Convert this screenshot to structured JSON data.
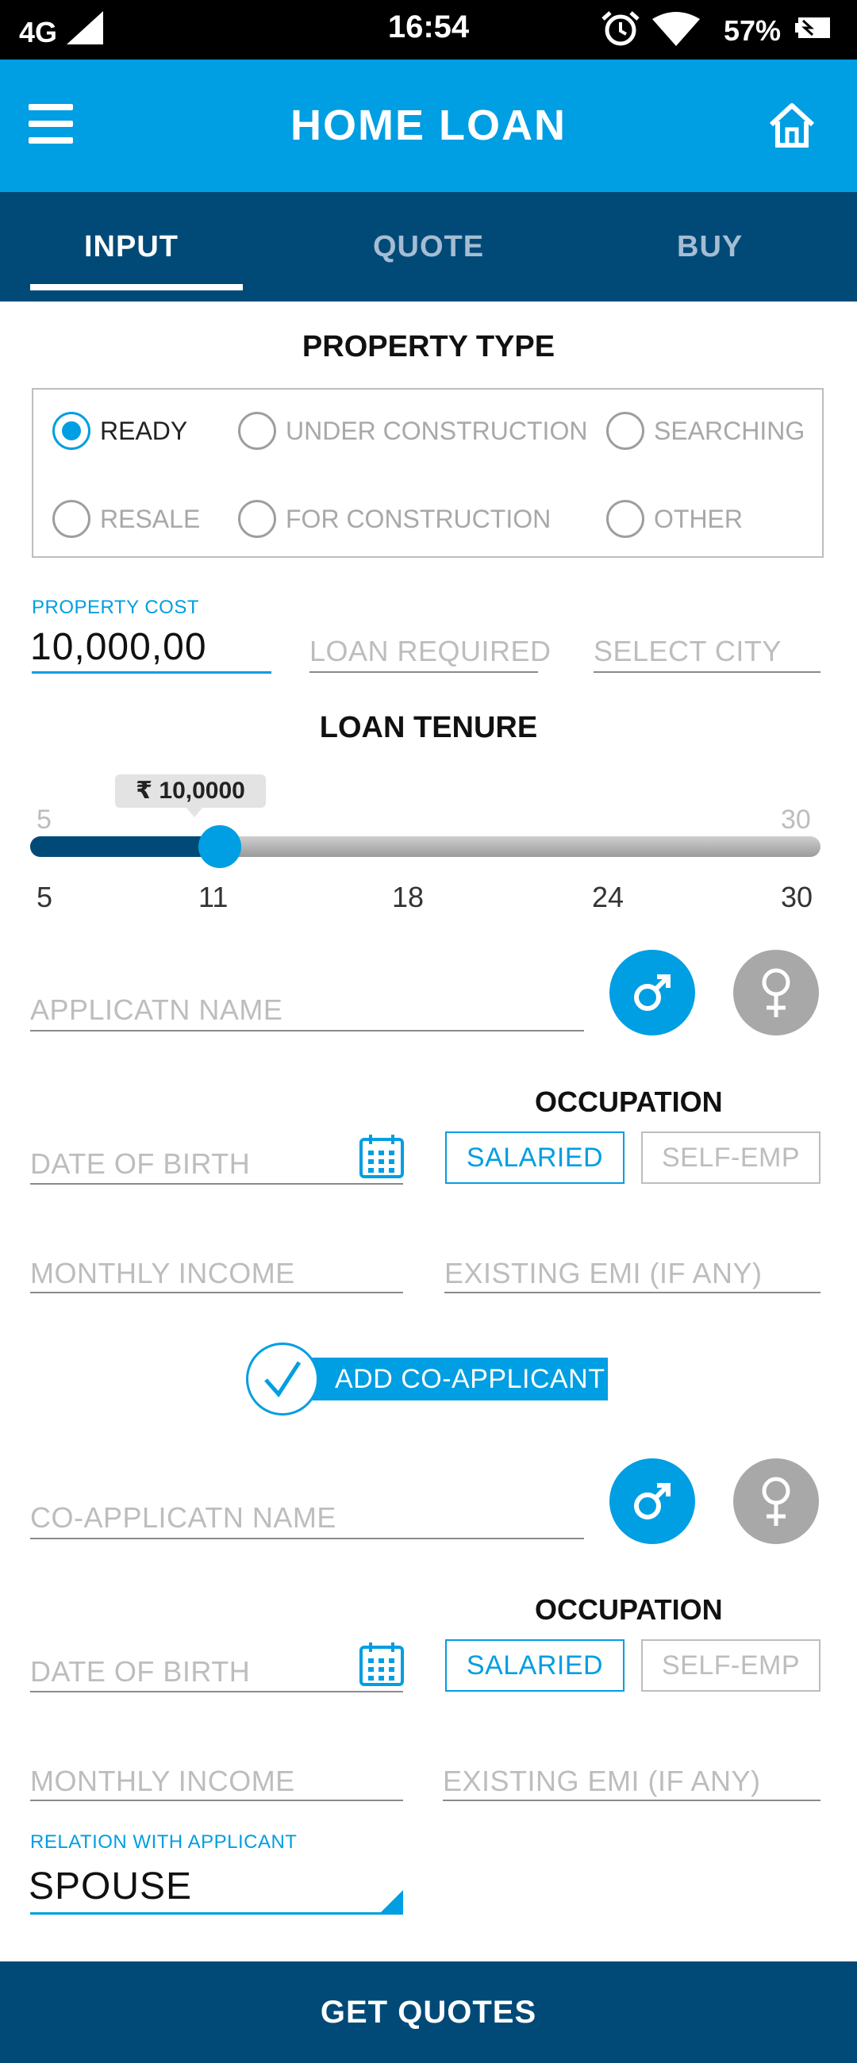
{
  "status_bar": {
    "network": "4G",
    "time": "16:54",
    "battery": "57%"
  },
  "app_bar": {
    "title": "HOME LOAN"
  },
  "tabs": [
    {
      "label": "INPUT",
      "active": true
    },
    {
      "label": "QUOTE",
      "active": false
    },
    {
      "label": "BUY",
      "active": false
    }
  ],
  "property_type": {
    "title": "PROPERTY TYPE",
    "options": [
      "READY",
      "UNDER CONSTRUCTION",
      "SEARCHING",
      "RESALE",
      "FOR CONSTRUCTION",
      "OTHER"
    ],
    "selected": "READY"
  },
  "cost_fields": {
    "property_cost_label": "PROPERTY COST",
    "property_cost_value": "10,000,00",
    "loan_required_placeholder": "LOAN REQUIRED",
    "select_city_placeholder": "SELECT CITY"
  },
  "loan_tenure": {
    "title": "LOAN TENURE",
    "tooltip": "₹ 10,0000",
    "min_label": "5",
    "max_label": "30",
    "ticks": [
      "5",
      "11",
      "18",
      "24",
      "30"
    ],
    "min": 5,
    "max": 30,
    "value": 11
  },
  "applicant": {
    "name_placeholder": "APPLICATN NAME",
    "occupation_title": "OCCUPATION",
    "dob_placeholder": "DATE OF BIRTH",
    "salaried_label": "SALARIED",
    "selfemp_label": "SELF-EMP",
    "income_placeholder": "MONTHLY INCOME",
    "emi_placeholder": "EXISTING EMI (IF ANY)",
    "gender_selected": "male"
  },
  "add_coapplicant_label": "ADD CO-APPLICANT",
  "coapplicant": {
    "name_placeholder": "CO-APPLICATN NAME",
    "occupation_title": "OCCUPATION",
    "dob_placeholder": "DATE OF BIRTH",
    "salaried_label": "SALARIED",
    "selfemp_label": "SELF-EMP",
    "income_placeholder": "MONTHLY INCOME",
    "emi_placeholder": "EXISTING EMI (IF ANY)",
    "relation_label": "RELATION WITH APPLICANT",
    "relation_value": "SPOUSE",
    "gender_selected": "male"
  },
  "cta_label": "GET QUOTES",
  "colors": {
    "primary": "#009ee2",
    "navy": "#014a78",
    "muted": "#a8a8a8"
  }
}
